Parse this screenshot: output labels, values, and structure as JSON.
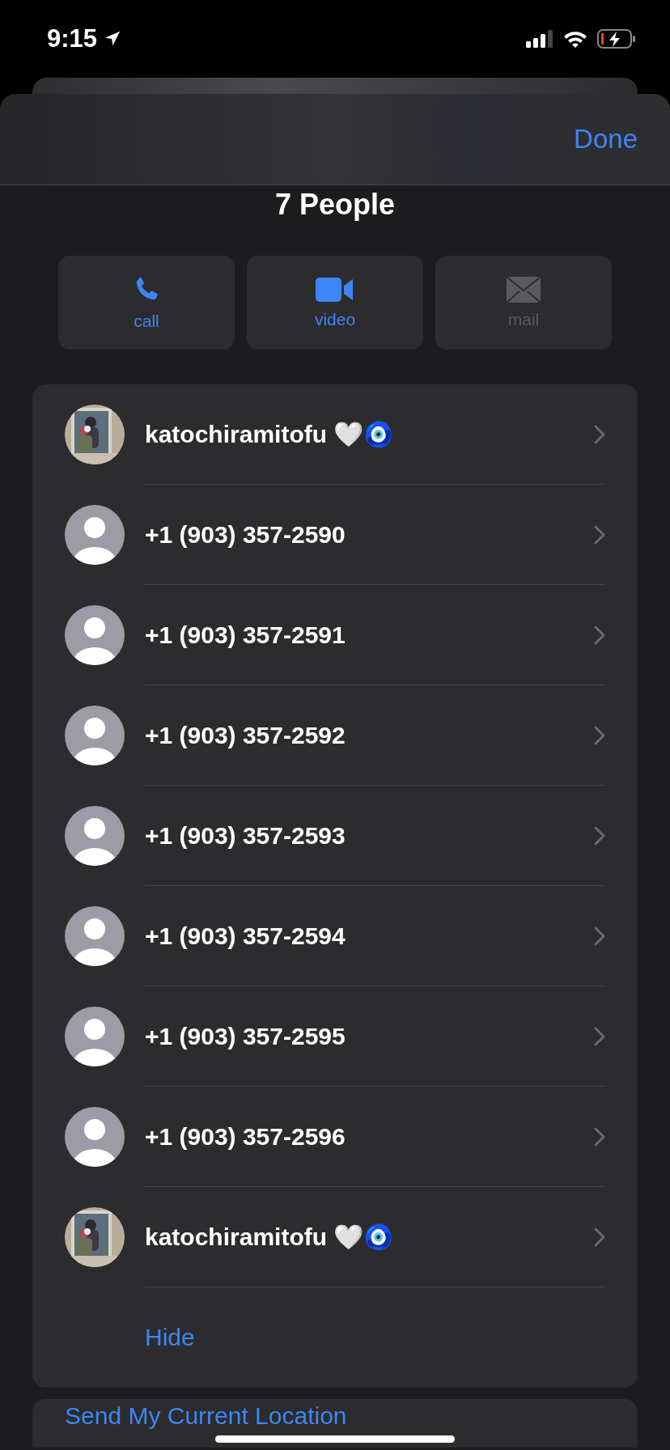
{
  "status_bar": {
    "time": "9:15"
  },
  "header": {
    "done": "Done"
  },
  "title": "7 People",
  "actions": [
    {
      "kind": "call",
      "label": "call",
      "disabled": false
    },
    {
      "kind": "video",
      "label": "video",
      "disabled": false
    },
    {
      "kind": "mail",
      "label": "mail",
      "disabled": true
    }
  ],
  "contacts": [
    {
      "name": "katochiramitofu 🤍🧿"
    },
    {
      "name": "+1 (903) 357-2590",
      "kind": "default"
    },
    {
      "name": "+1 (903) 357-2591",
      "kind": "default"
    },
    {
      "name": "+1 (903) 357-2592",
      "kind": "default"
    },
    {
      "name": "+1 (903) 357-2593",
      "kind": "default"
    },
    {
      "name": "+1 (903) 357-2594",
      "kind": "default"
    },
    {
      "name": "+1 (903) 357-2595",
      "kind": "default"
    },
    {
      "name": "+1 (903) 357-2596",
      "kind": "default"
    },
    {
      "name": "katochiramitofu 🤍🧿"
    }
  ],
  "hide_link": "Hide",
  "next_section": {
    "link": "Send My Current Location"
  }
}
